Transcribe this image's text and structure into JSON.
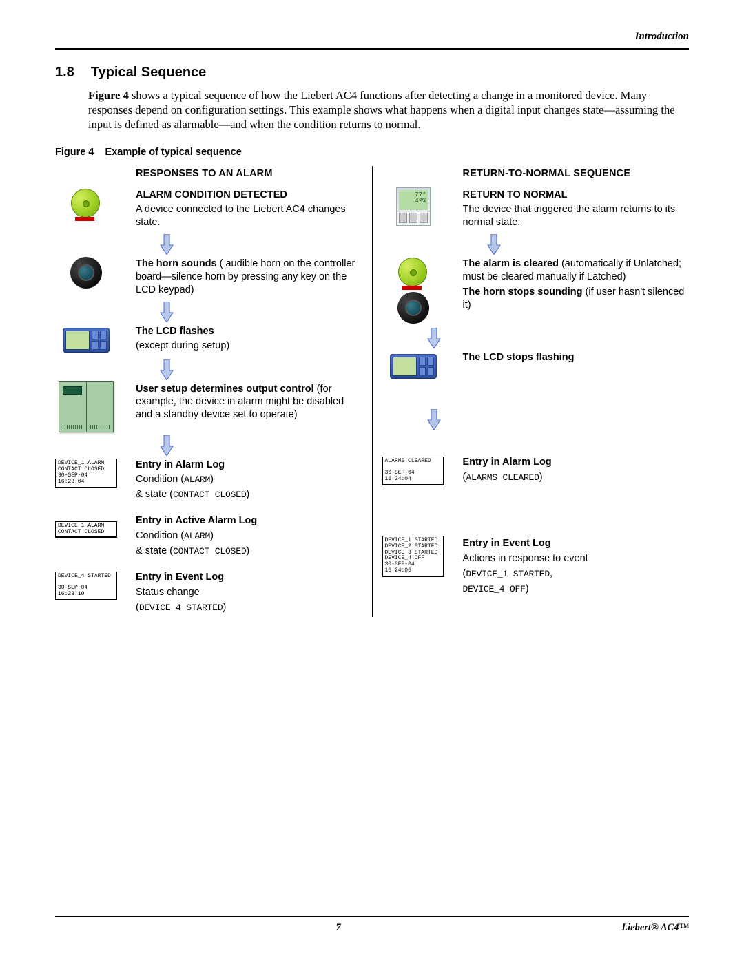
{
  "header": {
    "chapter": "Introduction"
  },
  "section": {
    "number": "1.8",
    "title": "Typical Sequence",
    "intro_prefix": "Figure 4",
    "intro_body": " shows a typical sequence of how the Liebert AC4 functions after detecting a change in a monitored device. Many responses depend on configuration settings. This example shows what happens when a digital input changes state—assuming the input is defined as alarmable—and when the condition returns to normal."
  },
  "figure": {
    "label": "Figure 4",
    "caption": "Example of typical sequence",
    "left_title": "RESPONSES TO AN ALARM",
    "right_title": "RETURN-TO-NORMAL SEQUENCE"
  },
  "left": [
    {
      "icon": "alarm-light",
      "bold": "ALARM CONDITION DETECTED",
      "rest": "A device connected to the Liebert AC4 changes state."
    },
    {
      "icon": "horn",
      "bold": "The horn sounds",
      "rest": " audible horn on the controller board—silence horn by pressing any key on the LCD keypad)",
      "rest_prefix_in_paren": " ("
    },
    {
      "icon": "lcd",
      "bold": "The LCD flashes",
      "rest": "(except during setup)"
    },
    {
      "icon": "device",
      "bold": "User setup determines output control",
      "rest": " (for example, the device in alarm might be disabled and a standby device set to operate)"
    },
    {
      "icon": "log1",
      "log": [
        "DEVICE_1 ALARM",
        "CONTACT CLOSED",
        "30-SEP-04   16:23:04"
      ],
      "bold": "Entry in Alarm Log",
      "lines": [
        "Condition (",
        "ALARM",
        ")"
      ],
      "lines2": [
        "& state (",
        "CONTACT CLOSED",
        ")"
      ]
    },
    {
      "icon": "log2",
      "log": [
        "DEVICE_1 ALARM",
        "CONTACT CLOSED"
      ],
      "bold": "Entry in Active Alarm Log",
      "lines": [
        "Condition (",
        "ALARM",
        ")"
      ],
      "lines2": [
        "& state (",
        "CONTACT CLOSED",
        ")"
      ]
    },
    {
      "icon": "log3",
      "log": [
        "DEVICE_4 STARTED",
        "",
        "30-SEP-04   16:23:10"
      ],
      "bold": "Entry in Event Log",
      "text_line": "Status change",
      "lines": [
        "(",
        "DEVICE_4 STARTED",
        ")"
      ]
    }
  ],
  "right": [
    {
      "icon": "thermo",
      "bold": "RETURN TO NORMAL",
      "rest": "The device that triggered the alarm returns to its normal state."
    },
    {
      "icon": "light+horn",
      "parts": [
        {
          "b": "The alarm is cleared",
          "t": " (automatically if Unlatched; must be cleared manually if Latched)"
        },
        {
          "b": "The horn stops sounding",
          "t": " (if user hasn't silenced it)"
        }
      ]
    },
    {
      "icon": "lcd",
      "bold": "The LCD stops flashing"
    },
    {
      "icon": "arrow-only"
    },
    {
      "icon": "log4",
      "log": [
        "ALARMS CLEARED",
        "",
        "30-SEP-04   16:24:04"
      ],
      "bold": "Entry in Alarm Log",
      "lines": [
        "(",
        "ALARMS CLEARED",
        ")"
      ]
    },
    {
      "icon": "log5",
      "log": [
        "DEVICE_1 STARTED",
        "DEVICE_2 STARTED",
        "DEVICE_3 STARTED",
        "DEVICE_4 OFF",
        "30-SEP-04   16:24:06"
      ],
      "bold": "Entry in Event Log",
      "text_line": "Actions in response to event",
      "lines": [
        "(",
        "DEVICE_1 STARTED",
        ","
      ],
      "lines2": [
        "",
        "DEVICE_4 OFF",
        ")"
      ]
    }
  ],
  "thermo_display": {
    "line1": "77°",
    "line2": "42%"
  },
  "footer": {
    "page": "7",
    "product": "Liebert® AC4™"
  }
}
